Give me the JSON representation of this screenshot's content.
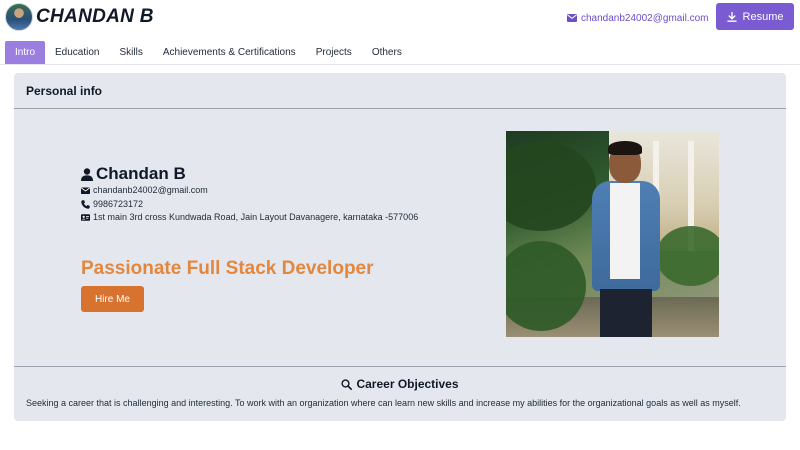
{
  "header": {
    "brand": "CHANDAN B",
    "email": "chandanb24002@gmail.com",
    "resume_label": "Resume"
  },
  "tabs": [
    {
      "label": "Intro",
      "active": true
    },
    {
      "label": "Education",
      "active": false
    },
    {
      "label": "Skills",
      "active": false
    },
    {
      "label": "Achievements & Certifications",
      "active": false
    },
    {
      "label": "Projects",
      "active": false
    },
    {
      "label": "Others",
      "active": false
    }
  ],
  "personal_info": {
    "section_title": "Personal info",
    "name": "Chandan B",
    "email": "chandanb24002@gmail.com",
    "phone": "9986723172",
    "address": "1st main 3rd cross Kundwada Road, Jain Layout Davanagere, karnataka -577006",
    "tagline": "Passionate Full Stack Developer",
    "hire_label": "Hire Me"
  },
  "career": {
    "title": "Career Objectives",
    "text": "Seeking a career that is challenging and interesting. To work with an organization where can learn new skills and increase my abilities for the organizational goals as well as myself."
  },
  "colors": {
    "accent": "#7a5bd1",
    "tab_active": "#9a7fe0",
    "tagline": "#e3873f",
    "hire_button": "#d8722f",
    "card_bg": "#e4e8ee"
  },
  "icons": [
    "mail-icon",
    "download-icon",
    "user-icon",
    "envelope-icon",
    "phone-icon",
    "id-card-icon",
    "search-icon"
  ]
}
